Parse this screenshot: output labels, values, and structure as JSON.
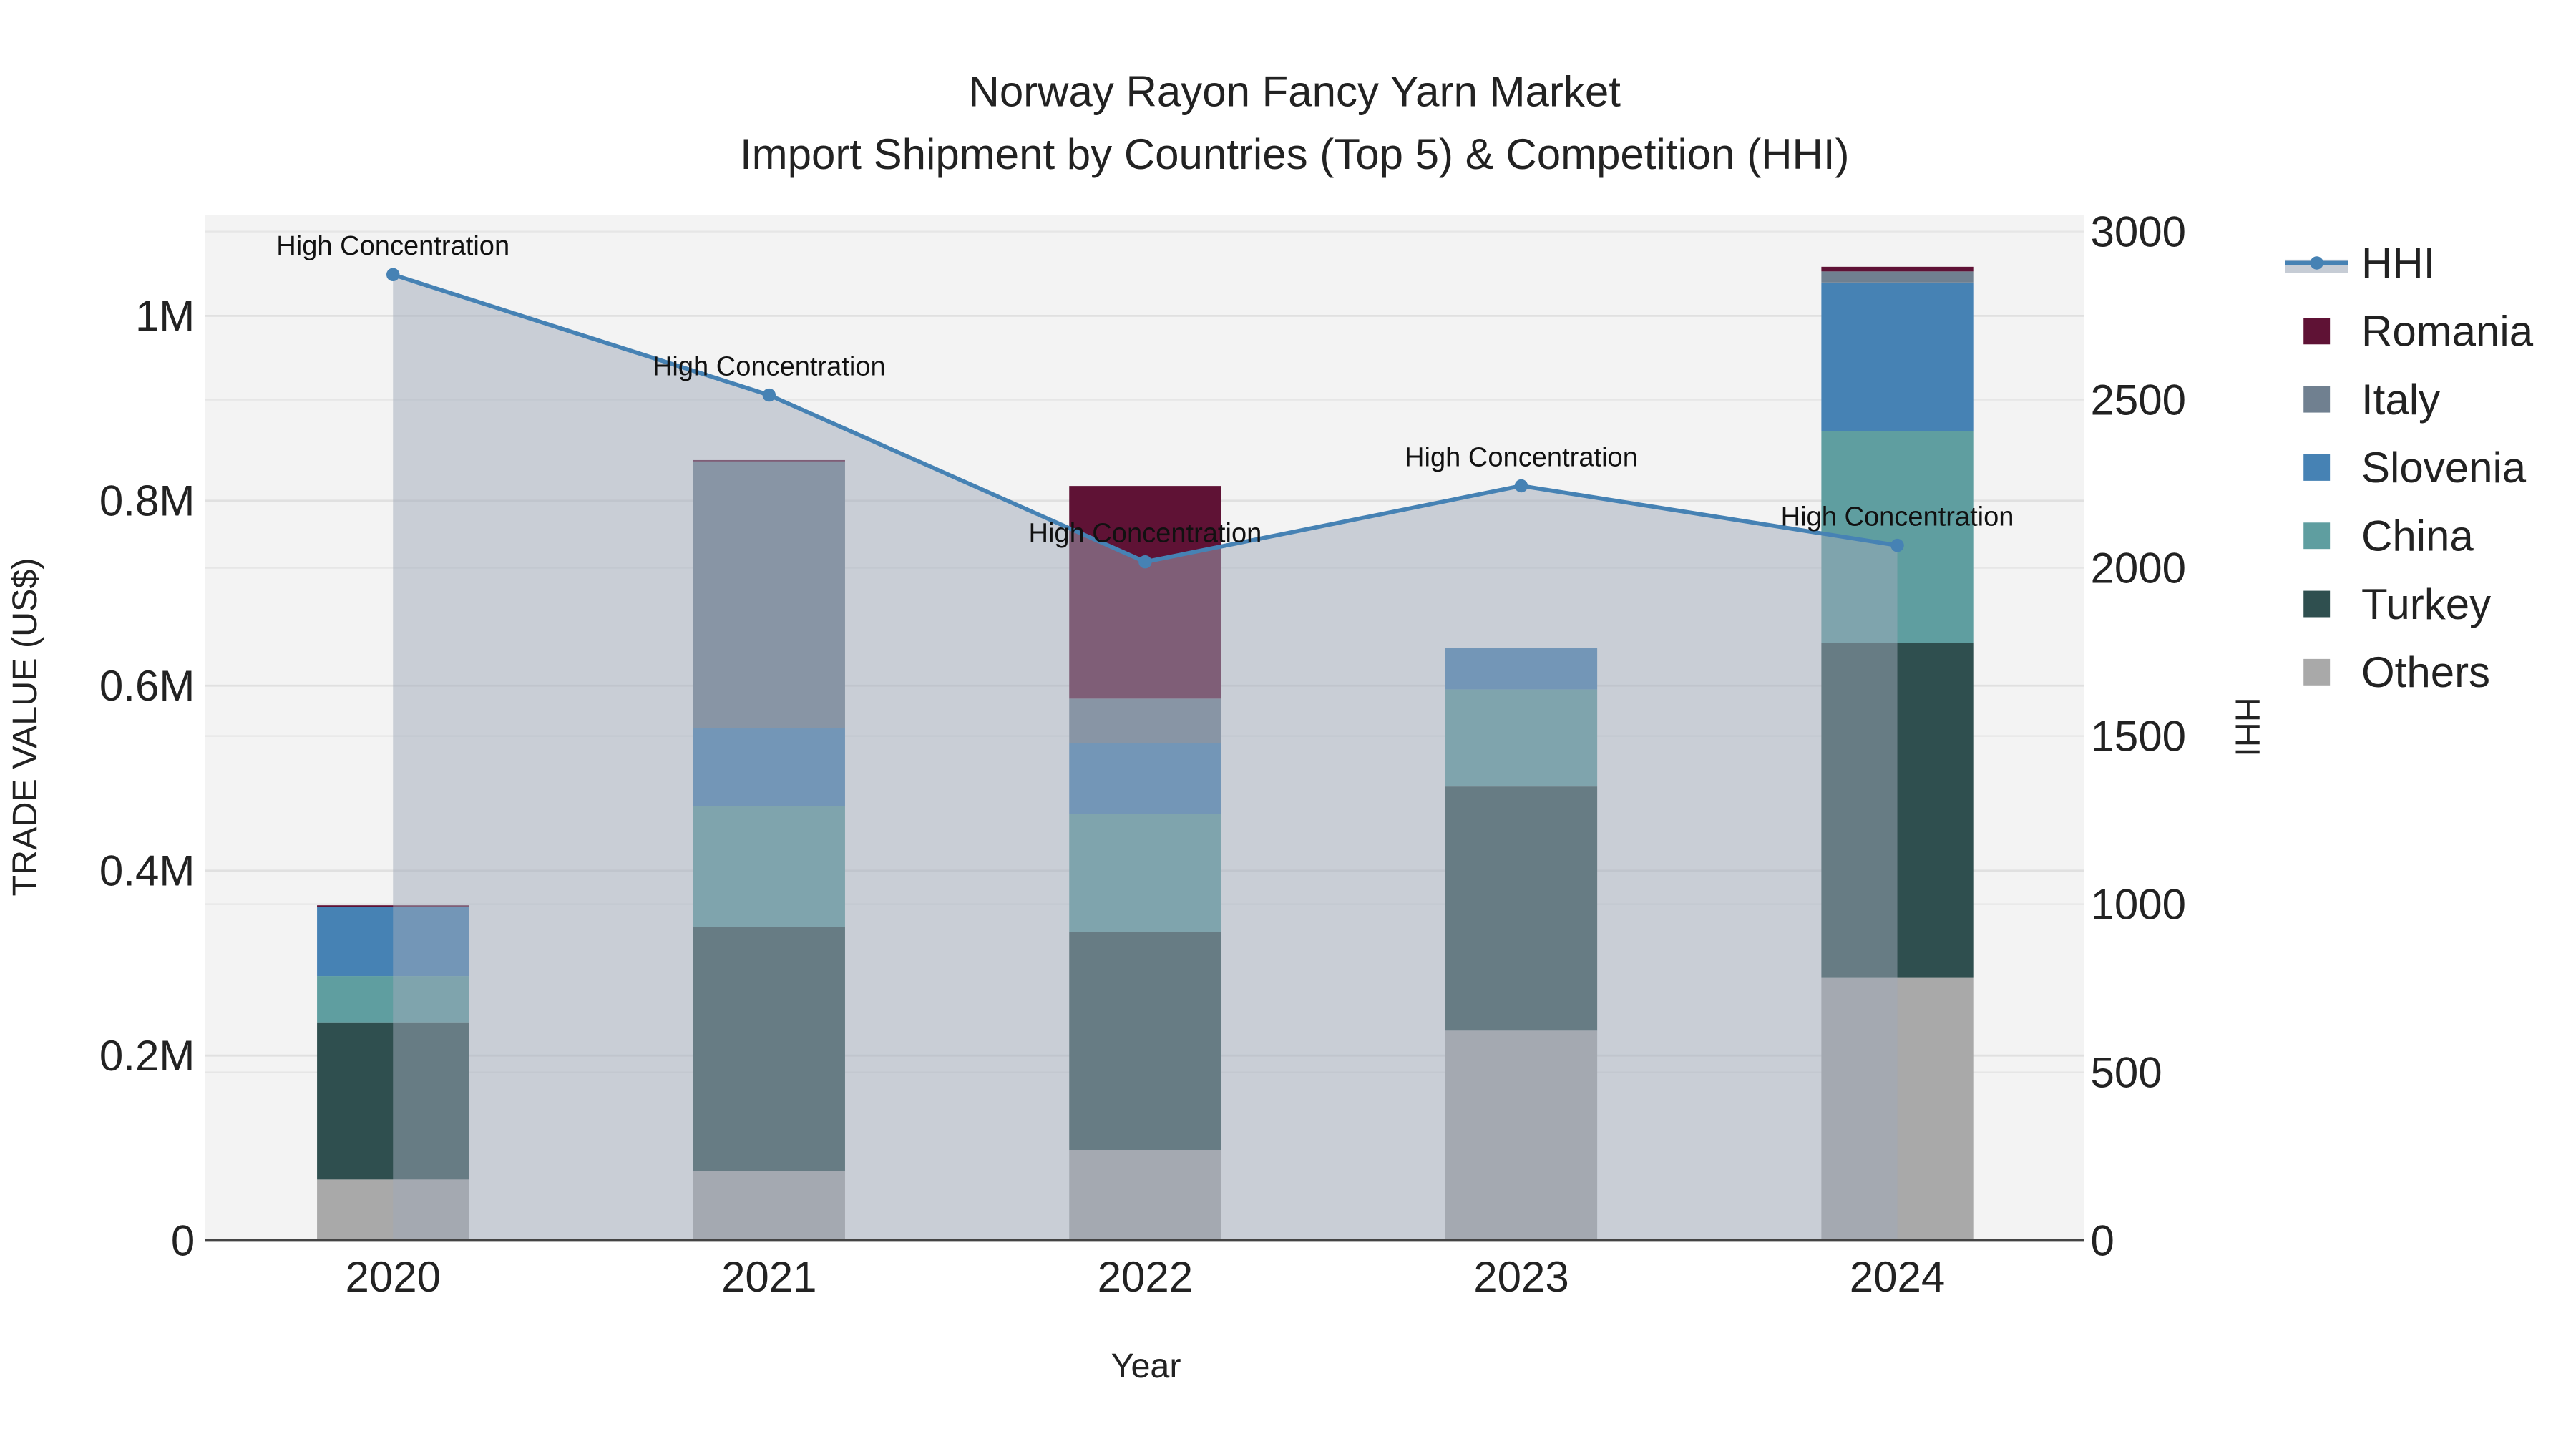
{
  "chart_data": {
    "type": "bar",
    "stacked": true,
    "title": "Norway Rayon Fancy Yarn Market",
    "subtitle": "Import Shipment by Countries (Top 5) & Competition (HHI)",
    "xlabel": "Year",
    "ylabel": "TRADE VALUE (US$)",
    "y2label": "HHI",
    "categories": [
      "2020",
      "2021",
      "2022",
      "2023",
      "2024"
    ],
    "ylim": [
      0,
      1100000
    ],
    "y2lim": [
      0,
      3050
    ],
    "yticks": [
      {
        "v": 0,
        "label": "0"
      },
      {
        "v": 200000,
        "label": "0.2M"
      },
      {
        "v": 400000,
        "label": "0.4M"
      },
      {
        "v": 600000,
        "label": "0.6M"
      },
      {
        "v": 800000,
        "label": "0.8M"
      },
      {
        "v": 1000000,
        "label": "1M"
      }
    ],
    "y2ticks": [
      {
        "v": 0,
        "label": "0"
      },
      {
        "v": 500,
        "label": "500"
      },
      {
        "v": 1000,
        "label": "1000"
      },
      {
        "v": 1500,
        "label": "1500"
      },
      {
        "v": 2000,
        "label": "2000"
      },
      {
        "v": 2500,
        "label": "2500"
      },
      {
        "v": 3000,
        "label": "3000"
      }
    ],
    "grid": true,
    "legend_position": "right",
    "series": [
      {
        "name": "Others",
        "color": "#a9a9a9",
        "values": [
          66000,
          75000,
          98000,
          227000,
          284000
        ]
      },
      {
        "name": "Turkey",
        "color": "#2f4f4f",
        "values": [
          170000,
          264000,
          236000,
          264000,
          362000
        ]
      },
      {
        "name": "China",
        "color": "#5f9ea0",
        "values": [
          50000,
          131000,
          127000,
          105000,
          229000
        ]
      },
      {
        "name": "Slovenia",
        "color": "#4682b4",
        "values": [
          75000,
          84000,
          77000,
          45000,
          161000
        ]
      },
      {
        "name": "Italy",
        "color": "#708090",
        "values": [
          1000,
          289000,
          48000,
          0,
          12000
        ]
      },
      {
        "name": "Romania",
        "color": "#5f1235",
        "values": [
          500,
          1000,
          230000,
          0,
          5000
        ]
      }
    ],
    "hhi": {
      "name": "HHI",
      "color": "#4682b4",
      "values": [
        2872,
        2514,
        2018,
        2244,
        2067
      ],
      "annotations": [
        "High Concentration",
        "High Concentration",
        "High Concentration",
        "High Concentration",
        "High Concentration"
      ]
    },
    "legend_order": [
      "HHI",
      "Romania",
      "Italy",
      "Slovenia",
      "China",
      "Turkey",
      "Others"
    ]
  }
}
